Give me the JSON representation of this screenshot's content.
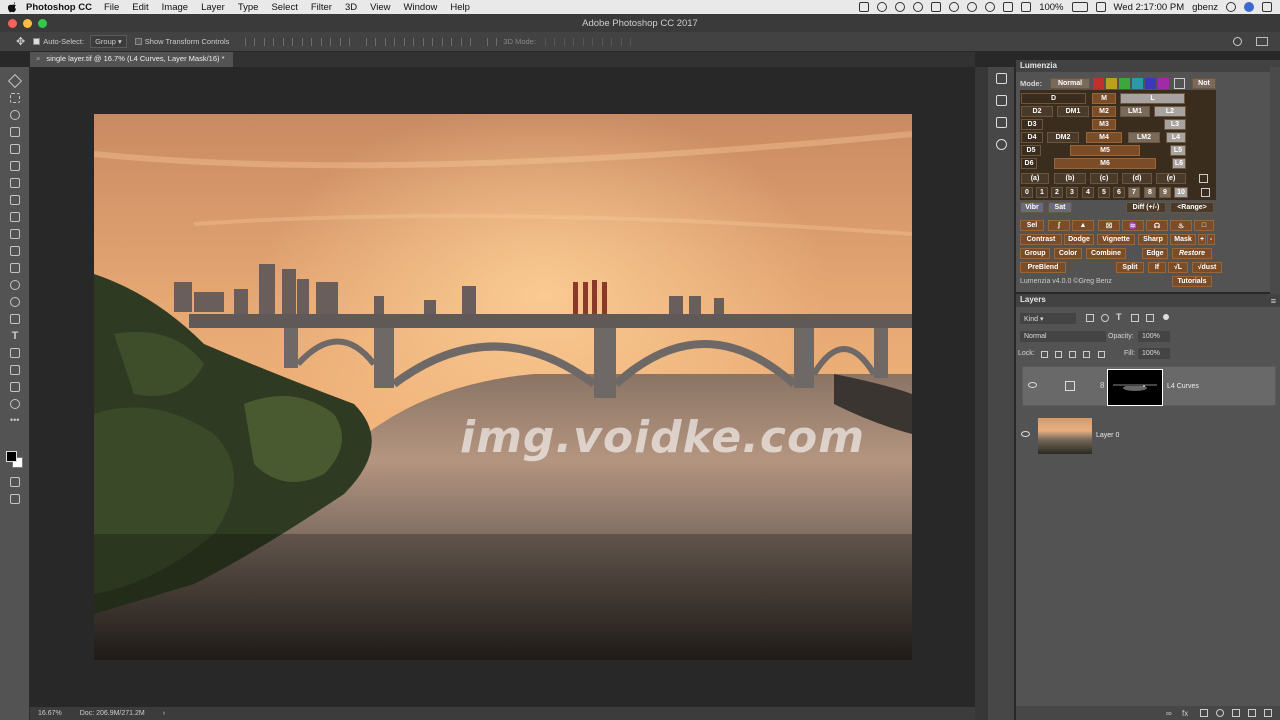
{
  "menubar": {
    "app": "Photoshop CC",
    "items": [
      "File",
      "Edit",
      "Image",
      "Layer",
      "Type",
      "Select",
      "Filter",
      "3D",
      "View",
      "Window",
      "Help"
    ],
    "battery": "100%",
    "clock": "Wed 2:17:00 PM",
    "user": "gbenz"
  },
  "window": {
    "title": "Adobe Photoshop CC 2017"
  },
  "options": {
    "auto_select_label": "Auto-Select:",
    "auto_select_value": "Group",
    "transform_label": "Show Transform Controls",
    "mode3d": "3D Mode:"
  },
  "document": {
    "tab": "single layer.tif @ 16.7% (L4 Curves, Layer Mask/16) *",
    "zoom": "16.67%",
    "doc_size": "Doc: 206.9M/271.2M"
  },
  "watermark": "img.voidke.com",
  "lumenzia": {
    "title": "Lumenzia",
    "mode_label": "Mode:",
    "mode_value": "Normal",
    "not": "Not",
    "x": "X",
    "swatch_colors": [
      "#c0302c",
      "#b8a020",
      "#3aa83a",
      "#2a9aa8",
      "#3a3ab8",
      "#a02aa8"
    ],
    "grid": {
      "D": "D",
      "M": "M",
      "L": "L",
      "D2": "D2",
      "DM1": "DM1",
      "M2": "M2",
      "LM1": "LM1",
      "L2": "L2",
      "D3": "D3",
      "M3": "M3",
      "L3": "L3",
      "D4": "D4",
      "DM2": "DM2",
      "M4": "M4",
      "LM2": "LM2",
      "L4": "L4",
      "D5": "D5",
      "M5": "M5",
      "L5": "L5",
      "D6": "D6",
      "M6": "M6",
      "L6": "L6"
    },
    "zones": [
      "(a)",
      "(b)",
      "(c)",
      "(d)",
      "(e)"
    ],
    "numbers": [
      "0",
      "1",
      "2",
      "3",
      "4",
      "5",
      "6",
      "7",
      "8",
      "9",
      "10"
    ],
    "vibr": "Vibr",
    "sat": "Sat",
    "diff": "Diff (+/-)",
    "range": "<Range>",
    "sel": "Sel",
    "contrast": "Contrast",
    "dodge": "Dodge",
    "vignette": "Vignette",
    "sharp": "Sharp",
    "mask": "Mask",
    "plus": "+",
    "minus": "-",
    "group": "Group",
    "color": "Color",
    "combine": "Combine",
    "edge": "Edge",
    "restore": "Restore",
    "preblend": "PreBlend",
    "split": "Split",
    "if": "If",
    "sqrtl": "√L",
    "sqrtdust": "√dust",
    "version": "Lumenzia v4.0.0 ©Greg Benz",
    "tutorials": "Tutorials"
  },
  "layers": {
    "title": "Layers",
    "kind": "Kind",
    "blend": "Normal",
    "opacity_label": "Opacity:",
    "opacity": "100%",
    "lock_label": "Lock:",
    "fill_label": "Fill:",
    "fill": "100%",
    "items": [
      {
        "name": "L4 Curves",
        "selected": true
      },
      {
        "name": "Layer 0",
        "selected": false
      }
    ]
  }
}
